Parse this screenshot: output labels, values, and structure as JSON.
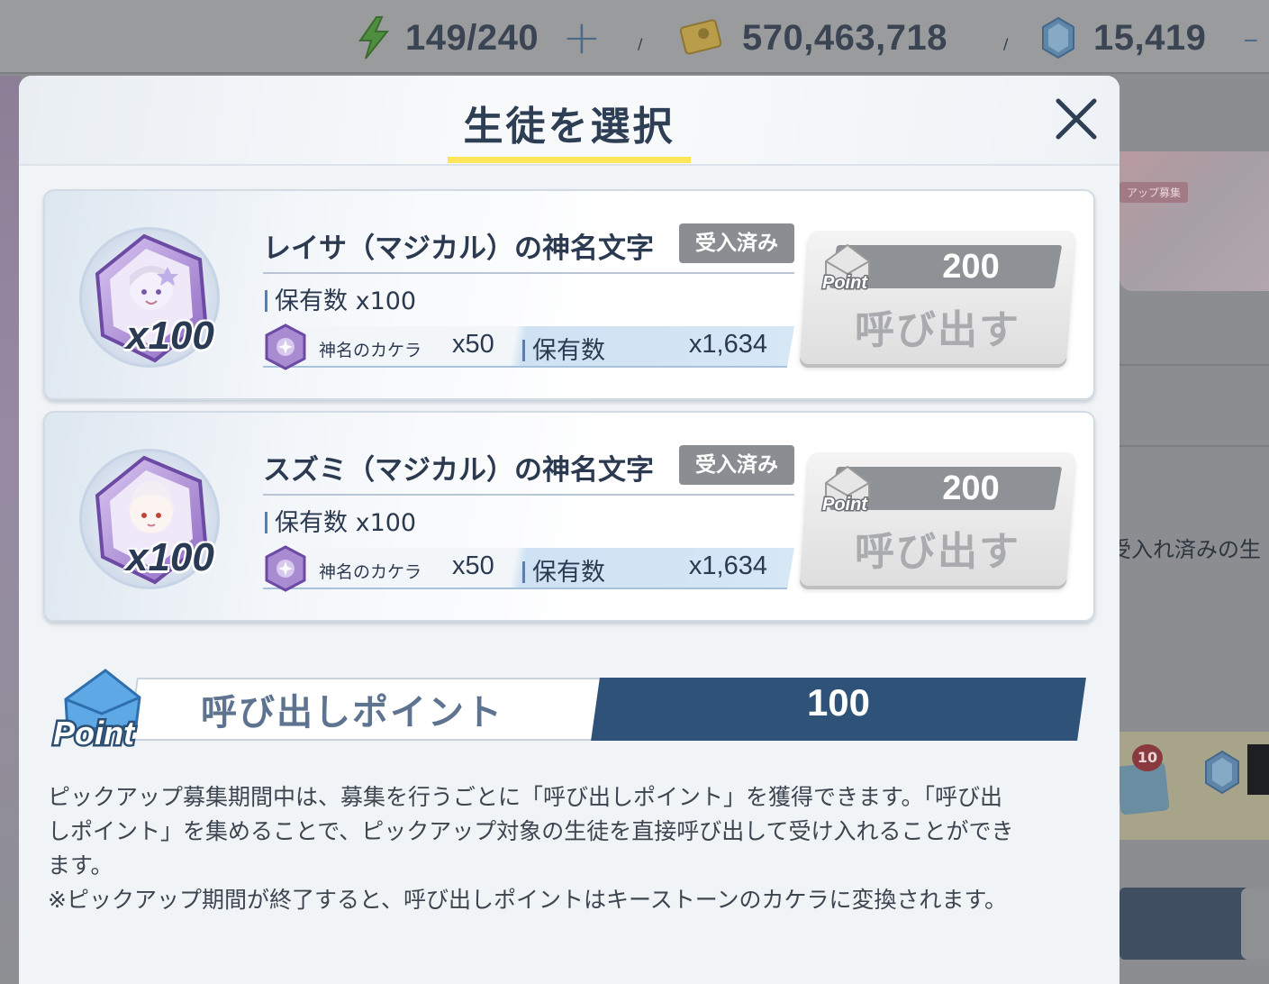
{
  "topbar": {
    "ap": "149/240",
    "credits": "570,463,718",
    "gems": "15,419",
    "colors": {
      "ap_icon": "#4caf50",
      "credit_icon": "#e7c24a",
      "gem_icon": "#6aa8e0"
    }
  },
  "background": {
    "banner_tag": "アップ募集",
    "side_text": "受入れ済みの生",
    "mail_badge": "10"
  },
  "dialog": {
    "title": "生徒を選択",
    "close_icon": "close-icon",
    "items": [
      {
        "name": "レイサ（マジカル）の神名文字",
        "status": "受入済み",
        "owned_label": "保有数",
        "owned_qty": "x100",
        "portrait_qty": "x100",
        "fragment_name": "神名のカケラ",
        "fragment_cost": "x50",
        "fragment_owned_label": "保有数",
        "fragment_owned": "x1,634",
        "call_cost": "200",
        "call_label": "呼び出す",
        "point_icon_text": "Point"
      },
      {
        "name": "スズミ（マジカル）の神名文字",
        "status": "受入済み",
        "owned_label": "保有数",
        "owned_qty": "x100",
        "portrait_qty": "x100",
        "fragment_name": "神名のカケラ",
        "fragment_cost": "x50",
        "fragment_owned_label": "保有数",
        "fragment_owned": "x1,634",
        "call_cost": "200",
        "call_label": "呼び出す",
        "point_icon_text": "Point"
      }
    ],
    "points": {
      "icon_text": "Point",
      "label": "呼び出しポイント",
      "value": "100"
    },
    "description": [
      "ピックアップ募集期間中は、募集を行うごとに「呼び出しポイント」を獲得できます。「呼び出",
      "しポイント」を集めることで、ピックアップ対象の生徒を直接呼び出して受け入れることができ",
      "ます。",
      "※ピックアップ期間が終了すると、呼び出しポイントはキーストーンのカケラに変換されます。"
    ]
  }
}
